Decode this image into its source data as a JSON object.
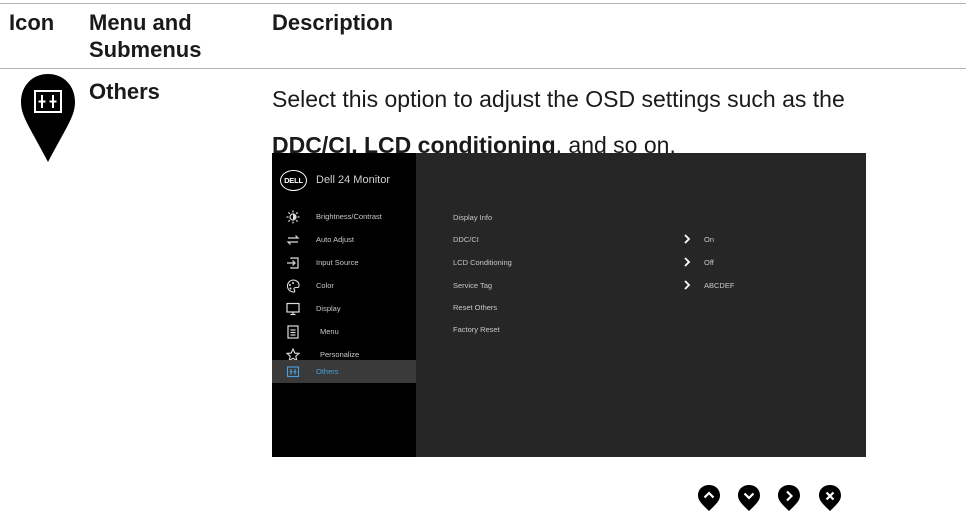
{
  "table": {
    "col_icon": "Icon",
    "col_menu_line1": "Menu and",
    "col_menu_line2": "Submenus",
    "col_description": "Description"
  },
  "section": {
    "name": "Others",
    "desc_1": "Select this option to adjust the OSD settings such as the",
    "desc_bold": "DDC/CI, LCD conditioning",
    "desc_2": ", and so on."
  },
  "osd": {
    "brand_logo": "DELL",
    "model": "Dell 24 Monitor",
    "menu": [
      {
        "label": "Brightness/Contrast",
        "icon": "brightness-icon"
      },
      {
        "label": "Auto Adjust",
        "icon": "auto-adjust-icon"
      },
      {
        "label": "Input Source",
        "icon": "input-source-icon"
      },
      {
        "label": "Color",
        "icon": "color-icon"
      },
      {
        "label": "Display",
        "icon": "display-icon"
      },
      {
        "label": "Menu",
        "icon": "menu-icon"
      },
      {
        "label": "Personalize",
        "icon": "star-icon"
      },
      {
        "label": "Others",
        "icon": "others-icon",
        "active": true
      }
    ],
    "submenu": [
      {
        "label": "Display Info"
      },
      {
        "label": "DDC/CI",
        "value": "On"
      },
      {
        "label": "LCD Conditioning",
        "value": "Off"
      },
      {
        "label": "Service Tag",
        "value": "ABCDEF"
      },
      {
        "label": "Reset Others"
      },
      {
        "label": "Factory Reset"
      }
    ],
    "accent_color": "#4a9fe0"
  },
  "nav_buttons": [
    "up-button",
    "down-button",
    "right-button",
    "close-button"
  ]
}
